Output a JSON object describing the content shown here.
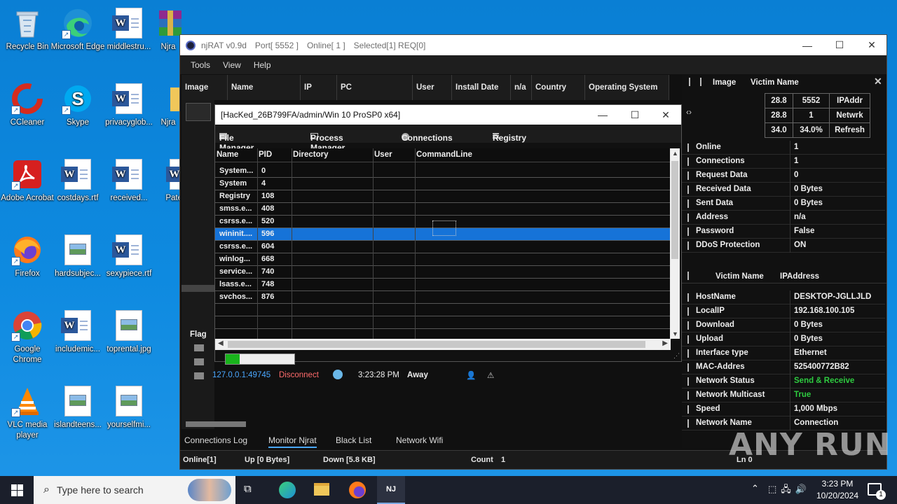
{
  "desktop": {
    "icons": [
      {
        "label": "Recycle Bin",
        "icon": "recycle-bin-icon"
      },
      {
        "label": "Microsoft Edge",
        "icon": "edge-icon"
      },
      {
        "label": "middlestru...",
        "icon": "word-doc-icon"
      },
      {
        "label": "Njra",
        "icon": "winrar-icon"
      },
      {
        "label": "CCleaner",
        "icon": "ccleaner-icon"
      },
      {
        "label": "Skype",
        "icon": "skype-icon"
      },
      {
        "label": "privacyglob...",
        "icon": "word-doc-icon"
      },
      {
        "label": "Njra",
        "icon": "folder-icon"
      },
      {
        "label": "Adobe Acrobat",
        "icon": "acrobat-icon"
      },
      {
        "label": "costdays.rtf",
        "icon": "word-doc-icon"
      },
      {
        "label": "received...",
        "icon": "word-doc-icon"
      },
      {
        "label": "Pate",
        "icon": "word-doc-icon"
      },
      {
        "label": "Firefox",
        "icon": "firefox-icon"
      },
      {
        "label": "hardsubjec...",
        "icon": "image-file-icon"
      },
      {
        "label": "sexypiece.rtf",
        "icon": "word-doc-icon"
      },
      {
        "label": "Google Chrome",
        "icon": "chrome-icon"
      },
      {
        "label": "includemic...",
        "icon": "word-doc-icon"
      },
      {
        "label": "toprental.jpg",
        "icon": "image-file-icon"
      },
      {
        "label": "VLC media player",
        "icon": "vlc-icon"
      },
      {
        "label": "islandteens...",
        "icon": "image-file-icon"
      },
      {
        "label": "yourselfmi...",
        "icon": "image-file-icon"
      }
    ]
  },
  "main": {
    "title": {
      "app": "njRAT v0.9d",
      "port": "Port[ 5552 ]",
      "online": "Online[ 1 ]",
      "selected": "Selected[1] REQ[0]"
    },
    "menu": [
      "Tools",
      "View",
      "Help"
    ],
    "columns": [
      "Image",
      "Name",
      "IP",
      "PC",
      "User",
      "Install Date",
      "n/a",
      "Country",
      "Operating System"
    ],
    "flag_label": "Flag",
    "conn_row": {
      "ip": "127.0.0.1:49745",
      "action": "Disconnect",
      "time": "3:23:28 PM",
      "status": "Away"
    },
    "tabs": [
      "Connections Log",
      "Monitor Njrat",
      "Black List",
      "Network Wifi"
    ],
    "status": {
      "online": "Online[1]",
      "up": "Up [0 Bytes]",
      "down": "Down [5.8 KB]",
      "count_label": "Count",
      "count": "1",
      "ln": "Ln 0"
    }
  },
  "right_panel": {
    "header": {
      "image": "Image",
      "victim": "Victim Name"
    },
    "table": [
      [
        "28.8",
        "5552",
        "IPAddr"
      ],
      [
        "28.8",
        "1",
        "Netwrk"
      ],
      [
        "34.0",
        "34.0%",
        "Refresh"
      ]
    ],
    "stats": [
      {
        "k": "Online",
        "v": "1"
      },
      {
        "k": "Connections",
        "v": "1"
      },
      {
        "k": "Request Data",
        "v": "0"
      },
      {
        "k": "Received Data",
        "v": "0 Bytes"
      },
      {
        "k": "Sent Data",
        "v": "0 Bytes"
      },
      {
        "k": "Address",
        "v": "n/a"
      },
      {
        "k": "Password",
        "v": "False"
      },
      {
        "k": "DDoS Protection",
        "v": "ON"
      }
    ],
    "victim_header": {
      "name": "Victim Name",
      "ip": "IPAddress"
    },
    "victim": [
      {
        "k": "HostName",
        "v": "DESKTOP-JGLLJLD"
      },
      {
        "k": "LocalIP",
        "v": "192.168.100.105"
      },
      {
        "k": "Download",
        "v": "0 Bytes"
      },
      {
        "k": "Upload",
        "v": "0 Bytes"
      },
      {
        "k": "Interface type",
        "v": "Ethernet"
      },
      {
        "k": "MAC-Addres",
        "v": "525400772B82"
      },
      {
        "k": "Network Status",
        "v": "Send & Receive"
      },
      {
        "k": "Network Multicast",
        "v": "True"
      },
      {
        "k": "Speed",
        "v": "1,000 Mbps"
      },
      {
        "k": "Network Name",
        "v": "Connection"
      }
    ],
    "accent_green": "#2ecc40"
  },
  "dialog": {
    "title": "[HacKed_26B799FA/admin/Win 10 ProSP0 x64]",
    "tabs": [
      "File Manager",
      "Process Manager",
      "Connections",
      "Registry"
    ],
    "columns": [
      "Name",
      "PID",
      "Directory",
      "User",
      "CommandLine"
    ],
    "rows": [
      {
        "name": "System...",
        "pid": "0"
      },
      {
        "name": "System",
        "pid": "4"
      },
      {
        "name": "Registry",
        "pid": "108"
      },
      {
        "name": "smss.e...",
        "pid": "408"
      },
      {
        "name": "csrss.e...",
        "pid": "520"
      },
      {
        "name": "wininit....",
        "pid": "596"
      },
      {
        "name": "csrss.e...",
        "pid": "604"
      },
      {
        "name": "winlog...",
        "pid": "668"
      },
      {
        "name": "service...",
        "pid": "740"
      },
      {
        "name": "lsass.e...",
        "pid": "748"
      },
      {
        "name": "svchos...",
        "pid": "876"
      }
    ],
    "selected_index": 5,
    "progress": 0.2
  },
  "taskbar": {
    "search_placeholder": "Type here to search",
    "time": "3:23 PM",
    "date": "10/20/2024",
    "notif_count": "1"
  },
  "watermark": "ANY RUN"
}
